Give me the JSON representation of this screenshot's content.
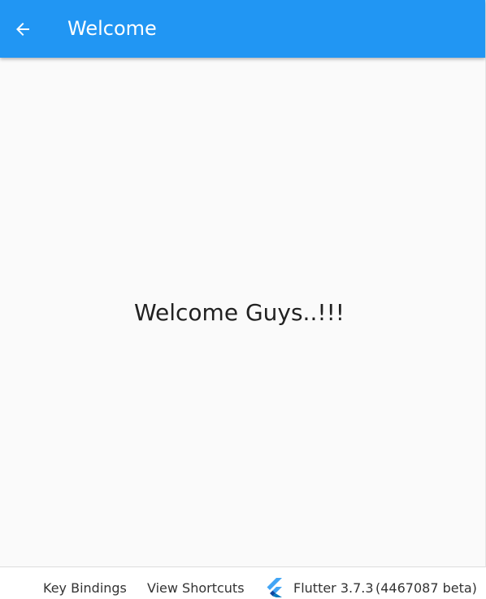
{
  "appbar": {
    "title": "Welcome",
    "back_icon": "arrow-back-icon",
    "color": "#2196f3"
  },
  "main": {
    "message": "Welcome Guys..!!!"
  },
  "statusbar": {
    "key_bindings": "Key Bindings",
    "view_shortcuts": "View Shortcuts",
    "flutter_icon": "flutter-logo-icon",
    "flutter_version": "Flutter 3.7.3",
    "flutter_build": "(4467087 beta)"
  }
}
